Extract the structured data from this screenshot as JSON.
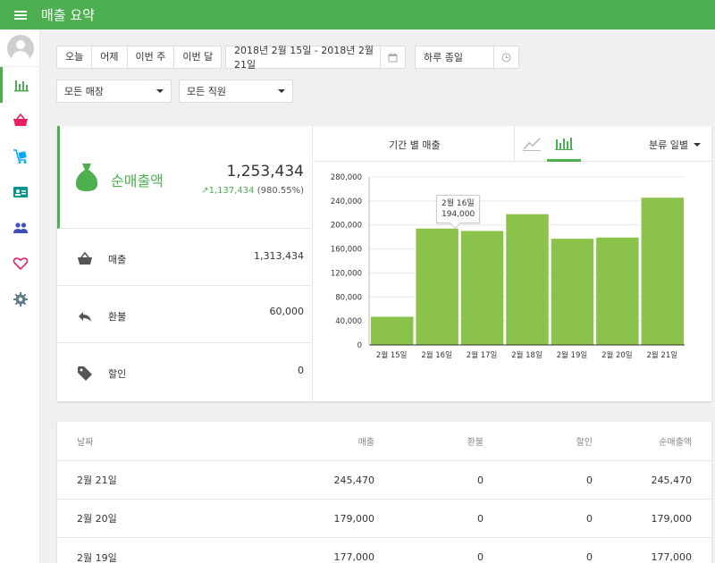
{
  "header": {
    "title": "매출 요약"
  },
  "sidebar": {
    "items": [
      "reports",
      "sales",
      "items",
      "employees",
      "customers",
      "favorites",
      "settings"
    ]
  },
  "toolbar": {
    "periods": [
      "오늘",
      "어제",
      "이번 주",
      "이번 달"
    ],
    "date_range": "2018년 2월 15일 - 2018년 2월 21일",
    "time_range": "하루 종일",
    "store_filter": "모든 매장",
    "employee_filter": "모든 직원"
  },
  "summary": {
    "net_label": "순매출액",
    "net_amount": "1,253,434",
    "net_change_value": "1,137,434",
    "net_change_percent": "(980.55%)",
    "sales_label": "매출",
    "sales_value": "1,313,434",
    "refunds_label": "환불",
    "refunds_value": "60,000",
    "discounts_label": "할인",
    "discounts_value": "0"
  },
  "chart_header": {
    "title": "기간 별 매출",
    "group_by": "분류 일별"
  },
  "tooltip": {
    "date": "2월 16일",
    "value": "194,000"
  },
  "chart_data": {
    "type": "bar",
    "categories": [
      "2월 15일",
      "2월 16일",
      "2월 17일",
      "2월 18일",
      "2월 19일",
      "2월 20일",
      "2월 21일"
    ],
    "values": [
      47000,
      194000,
      190000,
      218000,
      177000,
      179000,
      245470
    ],
    "ylim": [
      0,
      280000
    ],
    "yticks": [
      "0",
      "40,000",
      "80,000",
      "120,000",
      "160,000",
      "200,000",
      "240,000",
      "280,000"
    ],
    "grid": true,
    "colors": {
      "bar": "#8bc34a",
      "axis": "#333333"
    }
  },
  "table": {
    "headers": [
      "날짜",
      "매출",
      "환불",
      "할인",
      "순매출액"
    ],
    "rows": [
      [
        "2월 21일",
        "245,470",
        "0",
        "0",
        "245,470"
      ],
      [
        "2월 20일",
        "179,000",
        "0",
        "0",
        "179,000"
      ],
      [
        "2월 19일",
        "177,000",
        "0",
        "0",
        "177,000"
      ]
    ]
  }
}
